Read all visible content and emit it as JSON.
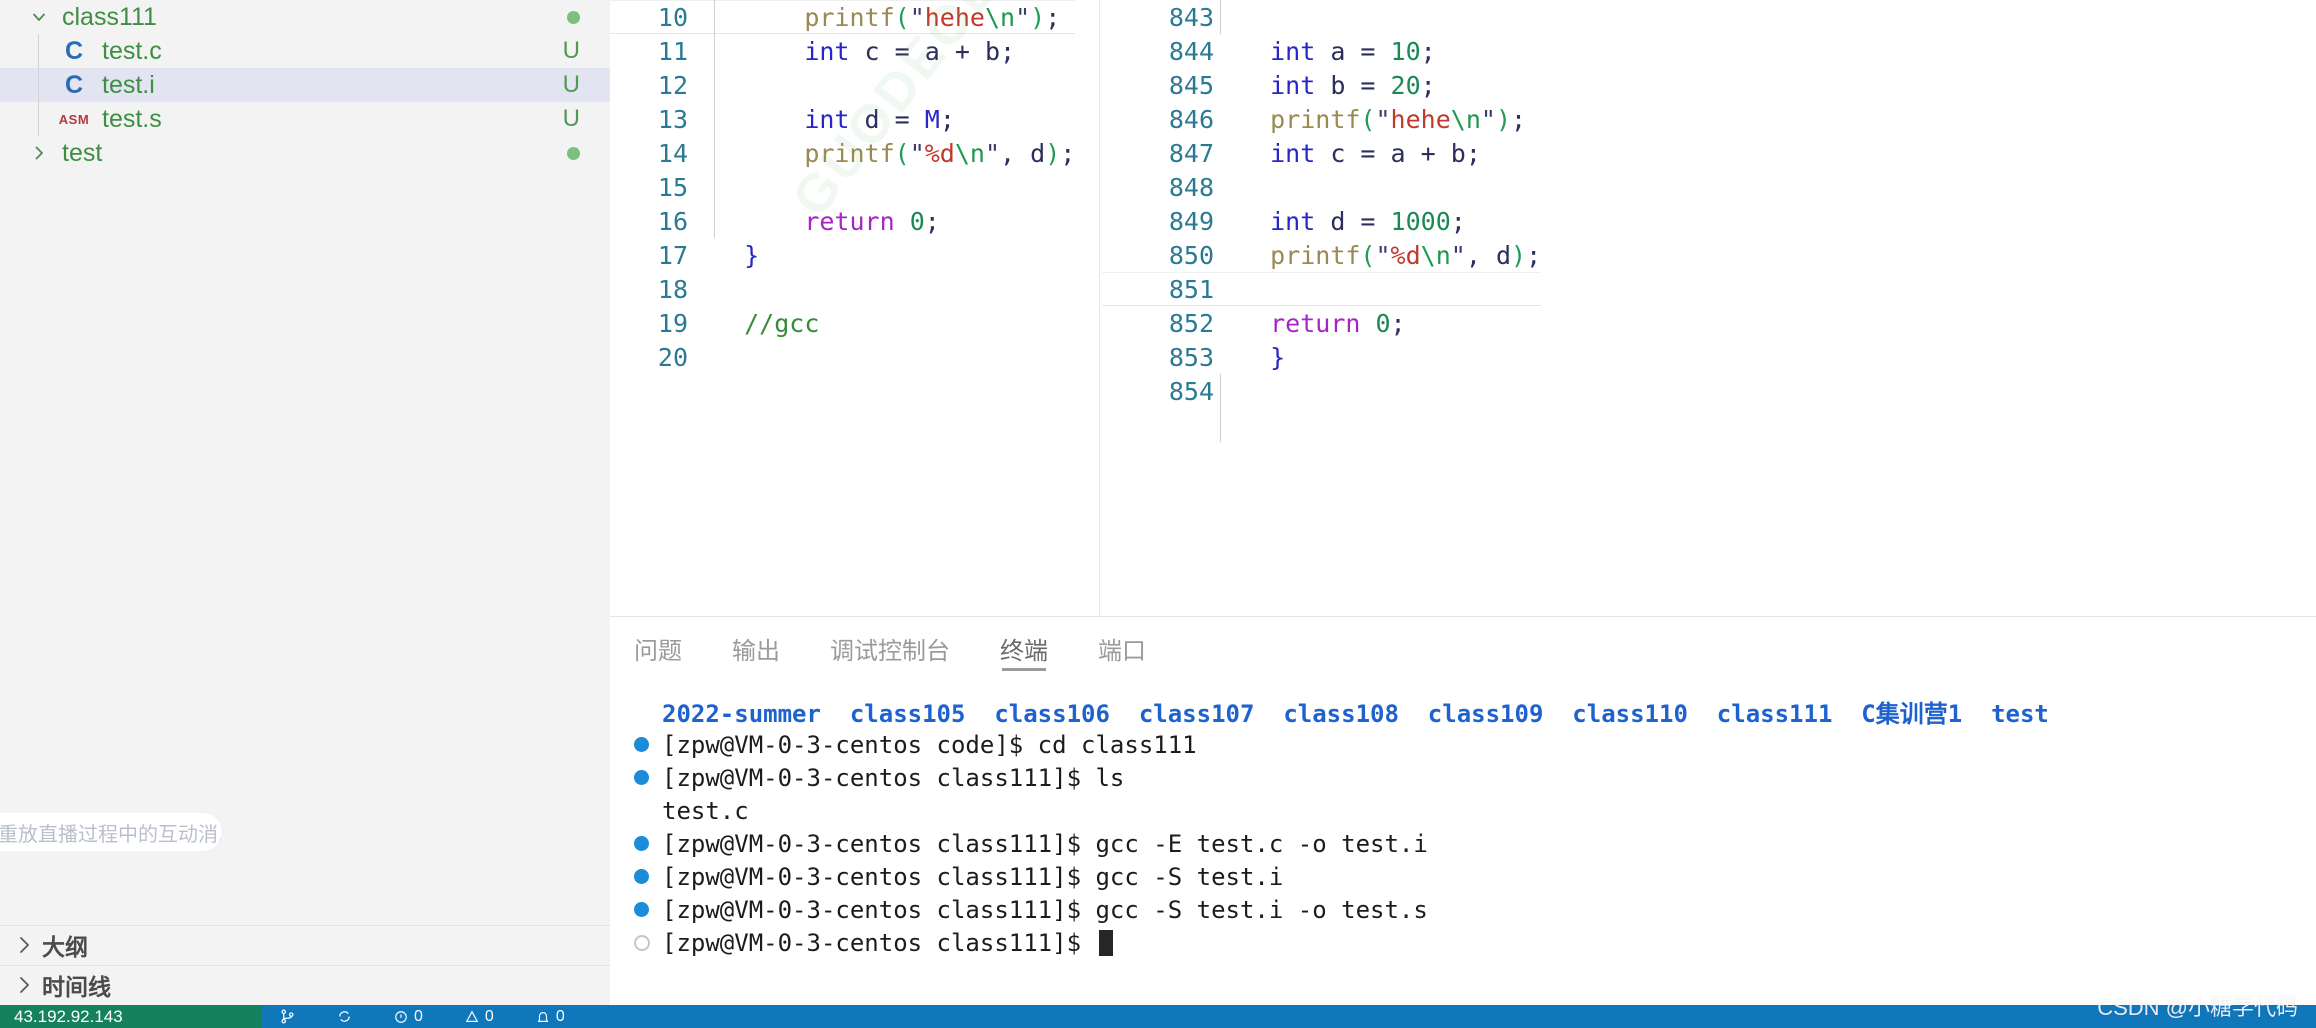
{
  "sidebar": {
    "tree": [
      {
        "type": "folder",
        "label": "class111",
        "expanded": true,
        "twisty": "chevron-down-icon",
        "badge": "",
        "status": "",
        "dot": true
      },
      {
        "type": "file",
        "label": "test.c",
        "expanded": false,
        "twisty": "",
        "badge": "C",
        "badge_kind": "c",
        "status": "U",
        "dot": false
      },
      {
        "type": "file",
        "label": "test.i",
        "expanded": false,
        "twisty": "",
        "badge": "C",
        "badge_kind": "c",
        "status": "U",
        "dot": false,
        "selected": true
      },
      {
        "type": "file",
        "label": "test.s",
        "expanded": false,
        "twisty": "",
        "badge": "ASM",
        "badge_kind": "asm",
        "status": "U",
        "dot": false
      },
      {
        "type": "folder",
        "label": "test",
        "expanded": false,
        "twisty": "chevron-right-icon",
        "badge": "",
        "status": "",
        "dot": true
      }
    ],
    "tooltip": "会重放直播过程中的互动消息",
    "sections": [
      {
        "label": "大纲",
        "twisty": "chevron-right-icon"
      },
      {
        "label": "时间线",
        "twisty": "chevron-right-icon"
      }
    ]
  },
  "editor": {
    "left_pane": {
      "watermark": "GUODEOLY",
      "lines": [
        {
          "n": "10",
          "tokens": [
            {
              "t": "      ",
              "c": "plain"
            },
            {
              "t": "printf",
              "c": "fn"
            },
            {
              "t": "(",
              "c": "paren"
            },
            {
              "t": "\"",
              "c": "quote"
            },
            {
              "t": "hehe",
              "c": "str"
            },
            {
              "t": "\\n",
              "c": "esc"
            },
            {
              "t": "\"",
              "c": "quote"
            },
            {
              "t": ")",
              "c": "paren"
            },
            {
              "t": ";",
              "c": "punct"
            }
          ],
          "current": true
        },
        {
          "n": "11",
          "tokens": [
            {
              "t": "      ",
              "c": "plain"
            },
            {
              "t": "int",
              "c": "kw"
            },
            {
              "t": " c ",
              "c": "ident"
            },
            {
              "t": "=",
              "c": "op"
            },
            {
              "t": " a ",
              "c": "ident"
            },
            {
              "t": "+",
              "c": "op"
            },
            {
              "t": " b",
              "c": "ident"
            },
            {
              "t": ";",
              "c": "punct"
            }
          ]
        },
        {
          "n": "12",
          "tokens": []
        },
        {
          "n": "13",
          "tokens": [
            {
              "t": "      ",
              "c": "plain"
            },
            {
              "t": "int",
              "c": "kw"
            },
            {
              "t": " d ",
              "c": "ident"
            },
            {
              "t": "=",
              "c": "op"
            },
            {
              "t": " ",
              "c": "plain"
            },
            {
              "t": "M",
              "c": "kw"
            },
            {
              "t": ";",
              "c": "punct"
            }
          ]
        },
        {
          "n": "14",
          "tokens": [
            {
              "t": "      ",
              "c": "plain"
            },
            {
              "t": "printf",
              "c": "fn"
            },
            {
              "t": "(",
              "c": "paren"
            },
            {
              "t": "\"",
              "c": "quote"
            },
            {
              "t": "%d",
              "c": "str"
            },
            {
              "t": "\\n",
              "c": "esc"
            },
            {
              "t": "\"",
              "c": "quote"
            },
            {
              "t": ",",
              "c": "punct"
            },
            {
              "t": " d",
              "c": "ident"
            },
            {
              "t": ")",
              "c": "paren"
            },
            {
              "t": ";",
              "c": "punct"
            }
          ]
        },
        {
          "n": "15",
          "tokens": []
        },
        {
          "n": "16",
          "tokens": [
            {
              "t": "      ",
              "c": "plain"
            },
            {
              "t": "return",
              "c": "kw2"
            },
            {
              "t": " ",
              "c": "plain"
            },
            {
              "t": "0",
              "c": "num"
            },
            {
              "t": ";",
              "c": "punct"
            }
          ]
        },
        {
          "n": "17",
          "tokens": [
            {
              "t": "  ",
              "c": "plain"
            },
            {
              "t": "}",
              "c": "brace"
            }
          ]
        },
        {
          "n": "18",
          "tokens": []
        },
        {
          "n": "19",
          "tokens": [
            {
              "t": "  ",
              "c": "plain"
            },
            {
              "t": "//gcc",
              "c": "comment"
            }
          ]
        },
        {
          "n": "20",
          "tokens": []
        }
      ]
    },
    "right_pane": {
      "lines": [
        {
          "n": "843",
          "tokens": []
        },
        {
          "n": "844",
          "tokens": [
            {
              "t": "  ",
              "c": "plain"
            },
            {
              "t": "int",
              "c": "kw"
            },
            {
              "t": " a ",
              "c": "ident"
            },
            {
              "t": "=",
              "c": "op"
            },
            {
              "t": " ",
              "c": "plain"
            },
            {
              "t": "10",
              "c": "num"
            },
            {
              "t": ";",
              "c": "punct"
            }
          ]
        },
        {
          "n": "845",
          "tokens": [
            {
              "t": "  ",
              "c": "plain"
            },
            {
              "t": "int",
              "c": "kw"
            },
            {
              "t": " b ",
              "c": "ident"
            },
            {
              "t": "=",
              "c": "op"
            },
            {
              "t": " ",
              "c": "plain"
            },
            {
              "t": "20",
              "c": "num"
            },
            {
              "t": ";",
              "c": "punct"
            }
          ]
        },
        {
          "n": "846",
          "tokens": [
            {
              "t": "  ",
              "c": "plain"
            },
            {
              "t": "printf",
              "c": "fn"
            },
            {
              "t": "(",
              "c": "paren"
            },
            {
              "t": "\"",
              "c": "quote"
            },
            {
              "t": "hehe",
              "c": "str"
            },
            {
              "t": "\\n",
              "c": "esc"
            },
            {
              "t": "\"",
              "c": "quote"
            },
            {
              "t": ")",
              "c": "paren"
            },
            {
              "t": ";",
              "c": "punct"
            }
          ]
        },
        {
          "n": "847",
          "tokens": [
            {
              "t": "  ",
              "c": "plain"
            },
            {
              "t": "int",
              "c": "kw"
            },
            {
              "t": " c ",
              "c": "ident"
            },
            {
              "t": "=",
              "c": "op"
            },
            {
              "t": " a ",
              "c": "ident"
            },
            {
              "t": "+",
              "c": "op"
            },
            {
              "t": " b",
              "c": "ident"
            },
            {
              "t": ";",
              "c": "punct"
            }
          ]
        },
        {
          "n": "848",
          "tokens": []
        },
        {
          "n": "849",
          "tokens": [
            {
              "t": "  ",
              "c": "plain"
            },
            {
              "t": "int",
              "c": "kw"
            },
            {
              "t": " d ",
              "c": "ident"
            },
            {
              "t": "=",
              "c": "op"
            },
            {
              "t": " ",
              "c": "plain"
            },
            {
              "t": "1000",
              "c": "num"
            },
            {
              "t": ";",
              "c": "punct"
            }
          ]
        },
        {
          "n": "850",
          "tokens": [
            {
              "t": "  ",
              "c": "plain"
            },
            {
              "t": "printf",
              "c": "fn"
            },
            {
              "t": "(",
              "c": "paren"
            },
            {
              "t": "\"",
              "c": "quote"
            },
            {
              "t": "%d",
              "c": "str"
            },
            {
              "t": "\\n",
              "c": "esc"
            },
            {
              "t": "\"",
              "c": "quote"
            },
            {
              "t": ",",
              "c": "punct"
            },
            {
              "t": " d",
              "c": "ident"
            },
            {
              "t": ")",
              "c": "paren"
            },
            {
              "t": ";",
              "c": "punct"
            }
          ]
        },
        {
          "n": "851",
          "tokens": [],
          "current": true
        },
        {
          "n": "852",
          "tokens": [
            {
              "t": "  ",
              "c": "plain"
            },
            {
              "t": "return",
              "c": "kw2"
            },
            {
              "t": " ",
              "c": "plain"
            },
            {
              "t": "0",
              "c": "num"
            },
            {
              "t": ";",
              "c": "punct"
            }
          ]
        },
        {
          "n": "853",
          "tokens": [
            {
              "t": "  ",
              "c": "plain"
            },
            {
              "t": "}",
              "c": "brace"
            }
          ]
        },
        {
          "n": "854",
          "tokens": []
        }
      ]
    }
  },
  "panel": {
    "tabs": [
      {
        "label": "问题",
        "active": false
      },
      {
        "label": "输出",
        "active": false
      },
      {
        "label": "调试控制台",
        "active": false
      },
      {
        "label": "终端",
        "active": true
      },
      {
        "label": "端口",
        "active": false
      }
    ],
    "terminal": {
      "directory_listing": "2022-summer  class105  class106  class107  class108  class109  class110  class111  C集训营1  test",
      "lines": [
        {
          "bullet": "filled",
          "text": "[zpw@VM-0-3-centos code]$ cd class111"
        },
        {
          "bullet": "filled",
          "text": "[zpw@VM-0-3-centos class111]$ ls"
        },
        {
          "bullet": "none",
          "text": "test.c"
        },
        {
          "bullet": "filled",
          "text": "[zpw@VM-0-3-centos class111]$ gcc -E test.c -o test.i"
        },
        {
          "bullet": "filled",
          "text": "[zpw@VM-0-3-centos class111]$ gcc -S test.i"
        },
        {
          "bullet": "filled",
          "text": "[zpw@VM-0-3-centos class111]$ gcc -S test.i -o test.s"
        },
        {
          "bullet": "hollow",
          "text": "[zpw@VM-0-3-centos class111]$ ",
          "cursor": true
        }
      ]
    }
  },
  "statusbar": {
    "remote": "43.192.92.143",
    "items": [
      {
        "icon": "branch-icon",
        "label": ""
      },
      {
        "icon": "sync-icon",
        "label": ""
      },
      {
        "icon": "error-icon",
        "label": "0"
      },
      {
        "icon": "warning-icon",
        "label": "0"
      },
      {
        "icon": "bell-icon",
        "label": "0"
      }
    ]
  },
  "watermark": {
    "csdn": "CSDN @小糖学代码"
  },
  "colors": {
    "sidebar_bg": "#f3f3f3",
    "selection": "#e3e4f1",
    "accent_blue": "#1177bb",
    "remote_green": "#16825d",
    "terminal_blue": "#1e62d0",
    "bullet_blue": "#1a8cd8"
  }
}
